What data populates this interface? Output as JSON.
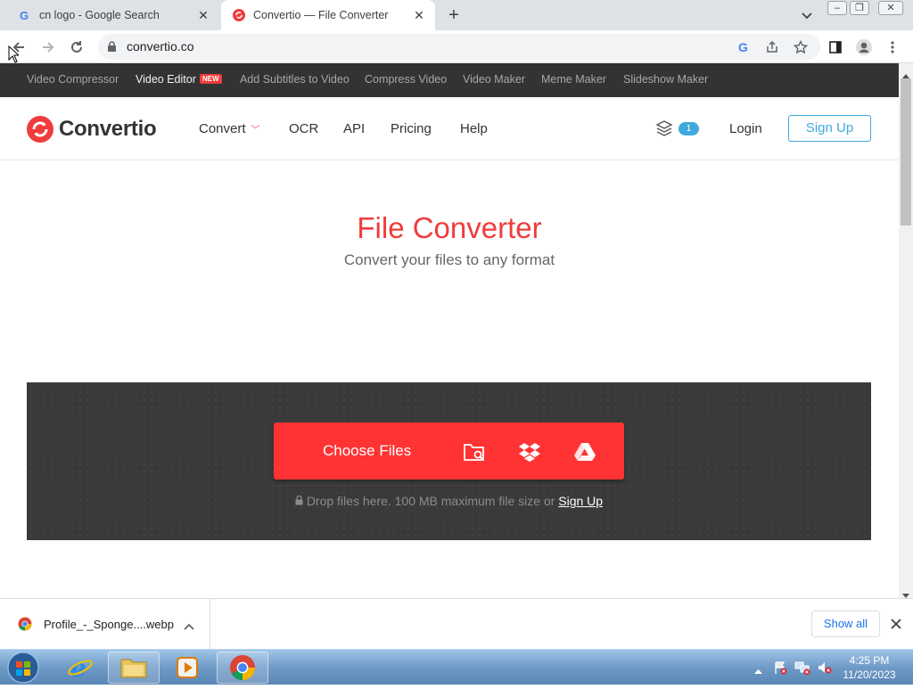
{
  "browser": {
    "tabs": [
      {
        "title": "cn logo - Google Search",
        "active": false
      },
      {
        "title": "Convertio — File Converter",
        "active": true
      }
    ],
    "url": "convertio.co"
  },
  "site": {
    "topbar": [
      {
        "label": "Video Compressor",
        "highlight": false
      },
      {
        "label": "Video Editor",
        "highlight": true,
        "badge": "NEW"
      },
      {
        "label": "Add Subtitles to Video",
        "highlight": false
      },
      {
        "label": "Compress Video",
        "highlight": false
      },
      {
        "label": "Video Maker",
        "highlight": false
      },
      {
        "label": "Meme Maker",
        "highlight": false
      },
      {
        "label": "Slideshow Maker",
        "highlight": false
      }
    ],
    "logo_text": "Convertio",
    "nav": {
      "convert": "Convert",
      "ocr": "OCR",
      "api": "API",
      "pricing": "Pricing",
      "help": "Help"
    },
    "layers_count": "1",
    "login": "Login",
    "signup": "Sign Up",
    "hero": {
      "title": "File Converter",
      "subtitle": "Convert your files to any format"
    },
    "dropzone": {
      "choose_label": "Choose Files",
      "hint_prefix": "Drop files here. 100 MB maximum file size or",
      "hint_link": "Sign Up"
    }
  },
  "download_bar": {
    "filename": "Profile_-_Sponge....webp",
    "show_all": "Show all"
  },
  "taskbar": {
    "time": "4:25 PM",
    "date": "11/20/2023"
  },
  "colors": {
    "brand_red": "#f03c3c",
    "accent_blue": "#3fa9dd",
    "topbar_bg": "#333333"
  }
}
